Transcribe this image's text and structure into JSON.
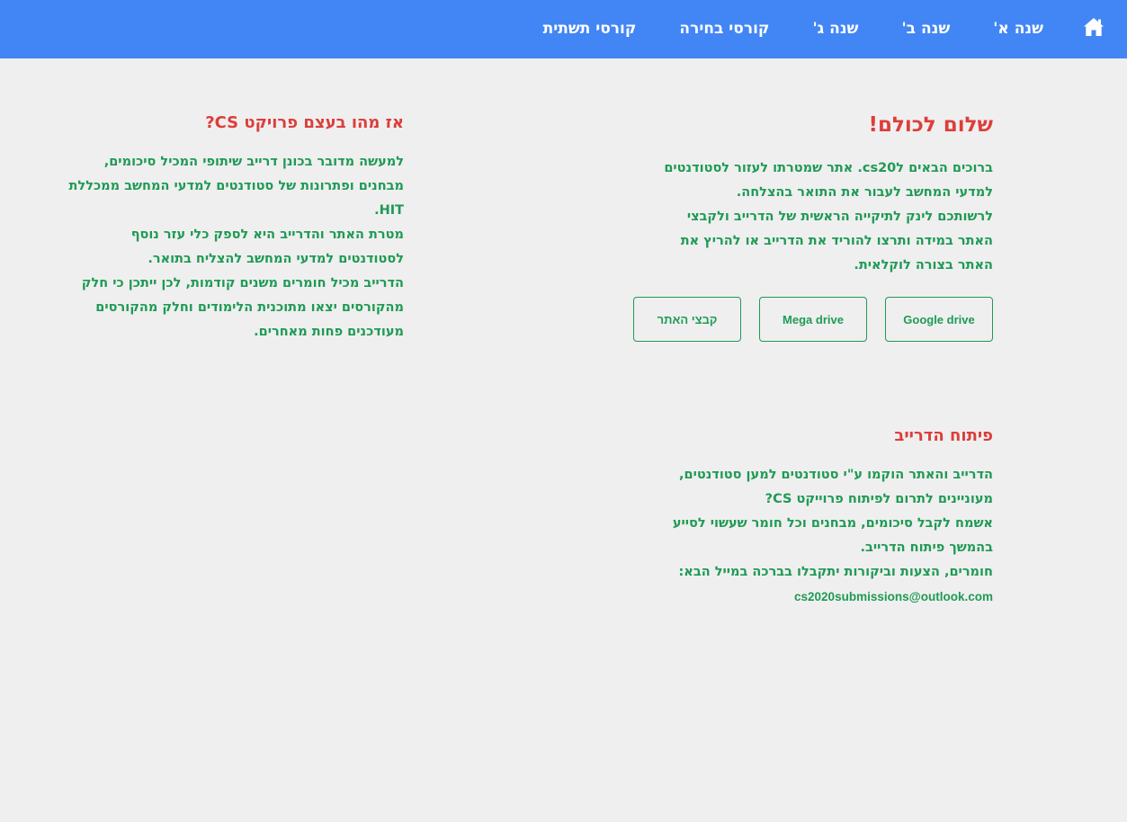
{
  "nav": {
    "home_icon": "home-icon",
    "items": [
      "שנה א'",
      "שנה ב'",
      "שנה ג'",
      "קורסי בחירה",
      "קורסי תשתית"
    ]
  },
  "welcome": {
    "title": "שלום לכולם!",
    "lines": [
      "ברוכים הבאים לcs20. אתר שמטרתו לעזור לסטודנטים",
      "למדעי המחשב לעבור את התואר בהצלחה.",
      "לרשותכם לינק לתיקייה הראשית של הדרייב ולקבצי",
      "האתר במידה ותרצו להוריד את הדרייב או להריץ את",
      "האתר בצורה לוקלאית."
    ],
    "buttons": [
      "Google drive",
      "Mega drive",
      "קבצי האתר"
    ]
  },
  "about": {
    "title": "אז מהו בעצם פרויקט CS?",
    "lines": [
      "למעשה מדובר בכונן דרייב שיתופי המכיל סיכומים,",
      "מבחנים ופתרונות של סטודנטים למדעי המחשב ממכללת",
      "HIT.",
      "מטרת האתר והדרייב היא לספק כלי עזר נוסף",
      "לסטודנטים למדעי המחשב להצליח בתואר.",
      "הדרייב מכיל חומרים משנים קודמות, לכן ייתכן כי חלק",
      "מהקורסים יצאו מתוכנית הלימודים וחלק מהקורסים",
      "מעודכנים פחות מאחרים."
    ]
  },
  "development": {
    "title": "פיתוח הדרייב",
    "lines": [
      "הדרייב והאתר הוקמו ע\"י סטודנטים למען סטודנטים,",
      "מעוניינים לתרום לפיתוח פרוייקט CS?",
      "אשמח לקבל סיכומים, מבחנים וכל חומר שעשוי לסייע",
      "בהמשך פיתוח הדרייב.",
      "חומרים, הצעות וביקורות יתקבלו בברכה במייל הבא:"
    ],
    "email": "cs2020submissions@outlook.com"
  },
  "colors": {
    "nav_bg": "#4286f5",
    "title": "#dc3e3a",
    "text": "#1f9a55",
    "page_bg": "#efefef"
  }
}
